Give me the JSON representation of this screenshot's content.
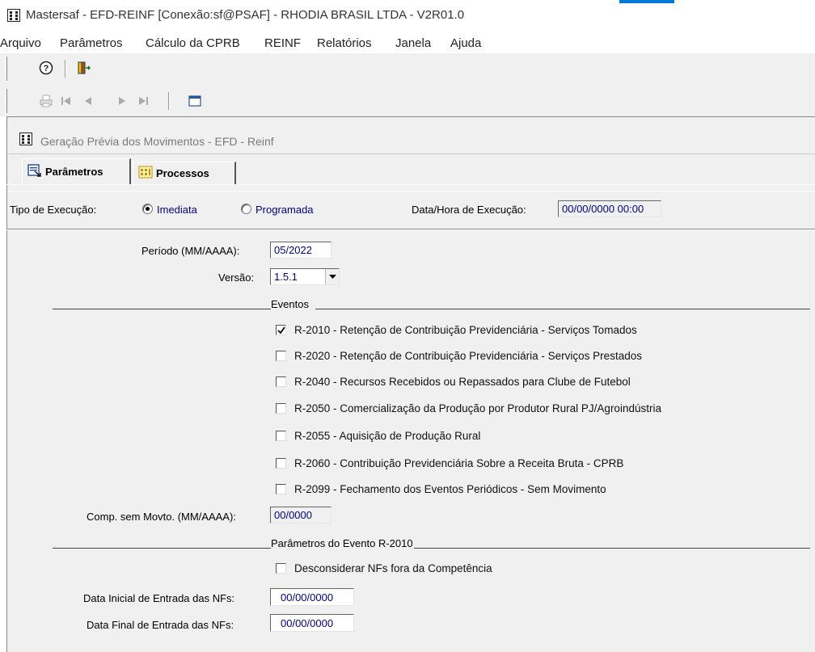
{
  "window": {
    "title": "Mastersaf - EFD-REINF [Conexão:sf@PSAF] - RHODIA BRASIL LTDA - V2R01.0"
  },
  "menu": {
    "items": [
      "Arquivo",
      "Parâmetros",
      "Cálculo da CPRB",
      "REINF",
      "Relatórios",
      "Janela",
      "Ajuda"
    ]
  },
  "toolbar": {
    "icons": [
      "help-icon",
      "exit-door-icon",
      "print-icon",
      "first-record-icon",
      "previous-record-icon",
      "next-record-icon",
      "last-record-icon",
      "window-icon"
    ]
  },
  "child_window": {
    "title": "Geração Prévia dos Movimentos - EFD - Reinf"
  },
  "tabs": [
    {
      "label": "Parâmetros",
      "active": true
    },
    {
      "label": "Processos",
      "active": false
    }
  ],
  "execution": {
    "label": "Tipo de Execução:",
    "option_immediate": "Imediata",
    "option_scheduled": "Programada",
    "selected": "Imediata",
    "datetime_label": "Data/Hora de Execução:",
    "datetime_value": "00/00/0000 00:00"
  },
  "params": {
    "period_label": "Período (MM/AAAA):",
    "period_value": "05/2022",
    "version_label": "Versão:",
    "version_value": "1.5.1",
    "events_title": "Eventos",
    "events": [
      {
        "label": "R-2010 - Retenção de Contribuição Previdenciária - Serviços Tomados",
        "checked": true
      },
      {
        "label": "R-2020 - Retenção de Contribuição Previdenciária - Serviços Prestados",
        "checked": false
      },
      {
        "label": "R-2040 - Recursos Recebidos ou Repassados para Clube de Futebol",
        "checked": false
      },
      {
        "label": "R-2050 - Comercialização da Produção por Produtor Rural PJ/Agroindústria",
        "checked": false
      },
      {
        "label": "R-2055 - Aquisição de Produção Rural",
        "checked": false
      },
      {
        "label": "R-2060 - Contribuição Previdenciária Sobre a Receita Bruta - CPRB",
        "checked": false
      },
      {
        "label": "R-2099 - Fechamento dos Eventos Periódicos - Sem Movimento",
        "checked": false
      }
    ],
    "comp_label": "Comp. sem Movto. (MM/AAAA):",
    "comp_value": "00/0000",
    "r2010_title": "Parâmetros do Evento R-2010",
    "disregard_label": "Desconsiderar NFs fora da Competência",
    "disregard_checked": false,
    "start_label": "Data Inicial de Entrada das NFs:",
    "start_value": "00/00/0000",
    "end_label": "Data Final de Entrada das NFs:",
    "end_value": "00/00/0000"
  }
}
